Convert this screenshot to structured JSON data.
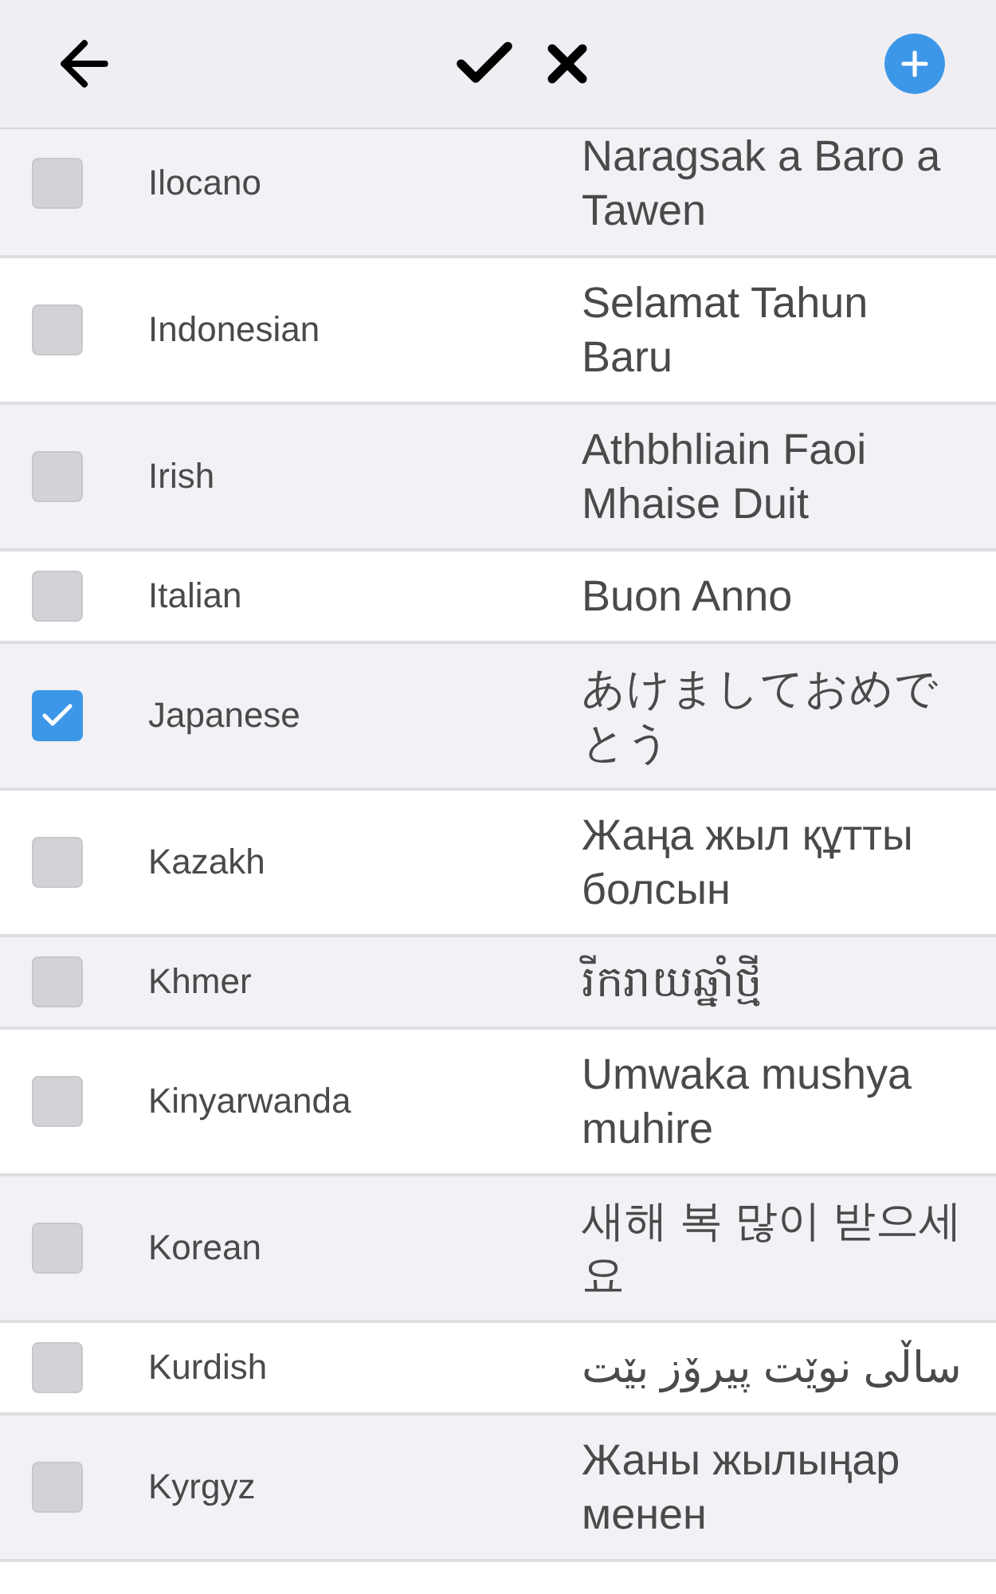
{
  "rows": [
    {
      "language": "Ilocano",
      "greeting": "Naragsak a Baro a Tawen",
      "checked": false
    },
    {
      "language": "Indonesian",
      "greeting": "Selamat Tahun Baru",
      "checked": false
    },
    {
      "language": "Irish",
      "greeting": "Athbhliain Faoi Mhaise Duit",
      "checked": false
    },
    {
      "language": "Italian",
      "greeting": "Buon Anno",
      "checked": false
    },
    {
      "language": "Japanese",
      "greeting": "あけましておめでとう",
      "checked": true
    },
    {
      "language": "Kazakh",
      "greeting": "Жаңа жыл құтты болсын",
      "checked": false
    },
    {
      "language": "Khmer",
      "greeting": "រីករាយឆ្នាំថ្មី",
      "checked": false
    },
    {
      "language": "Kinyarwanda",
      "greeting": "Umwaka mushya muhire",
      "checked": false
    },
    {
      "language": "Korean",
      "greeting": "새해 복 많이 받으세요",
      "checked": false
    },
    {
      "language": "Kurdish",
      "greeting": "ساڵی نوێت پیرۆز بێت",
      "checked": false
    },
    {
      "language": "Kyrgyz",
      "greeting": "Жаны жылыңар менен",
      "checked": false
    }
  ]
}
